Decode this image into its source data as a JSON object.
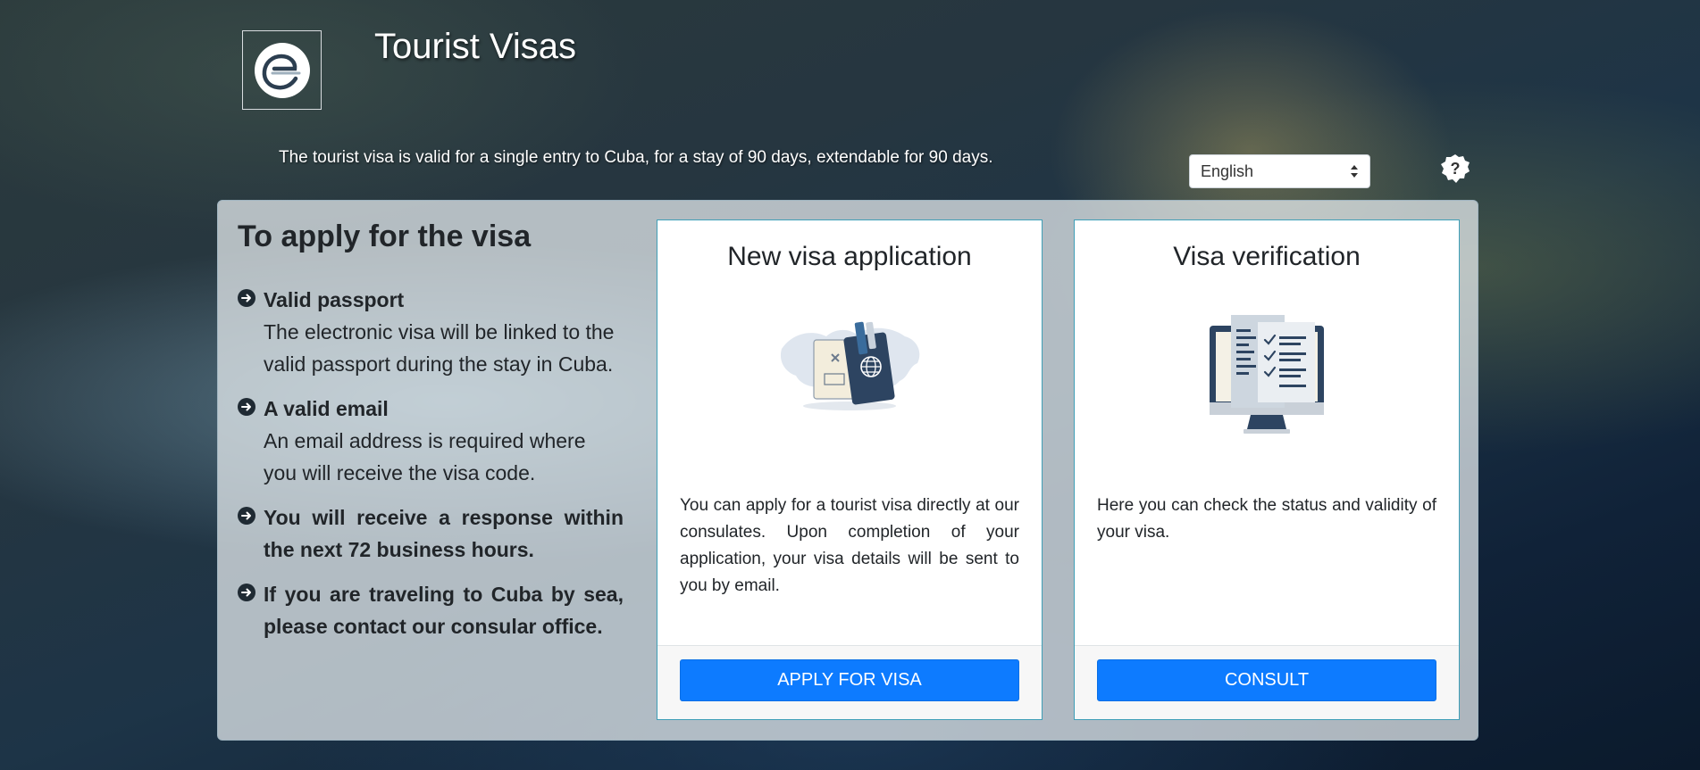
{
  "header": {
    "logo_icon": "e-logo-icon",
    "title": "Tourist Visas",
    "intro": "The tourist visa is valid for a single entry to Cuba, for a stay of 90 days, extendable for 90 days."
  },
  "language": {
    "selected": "English",
    "icon": "up-down-caret-icon"
  },
  "help": {
    "icon": "question-mark-icon"
  },
  "requirements": {
    "title": "To apply for the visa",
    "bullet_icon": "arrow-circle-right-icon",
    "items": [
      {
        "heading": "Valid passport",
        "description": "The electronic visa will be linked to the valid passport during the stay in Cuba."
      },
      {
        "heading": "A valid email",
        "description": "An email address is required where you will receive the visa code."
      },
      {
        "heading": "You will receive a response within the next 72 business hours.",
        "description": ""
      },
      {
        "heading": "If you are traveling to Cuba by sea, please contact our consular office.",
        "description": ""
      }
    ]
  },
  "cards": {
    "new_application": {
      "title": "New visa application",
      "illustration": "passport-world-map-icon",
      "text": "You can apply for a tourist visa directly at our consulates. Upon completion of your application, your visa details will be sent to you by email.",
      "button": "APPLY FOR VISA"
    },
    "verification": {
      "title": "Visa verification",
      "illustration": "monitor-checklist-icon",
      "text": "Here you can check the status and validity of your visa.",
      "button": "CONSULT"
    }
  },
  "colors": {
    "primary_button": "#0d7bff",
    "card_border": "#3f9fb7",
    "text_dark": "#212529",
    "illustration_navy": "#2d4461"
  }
}
